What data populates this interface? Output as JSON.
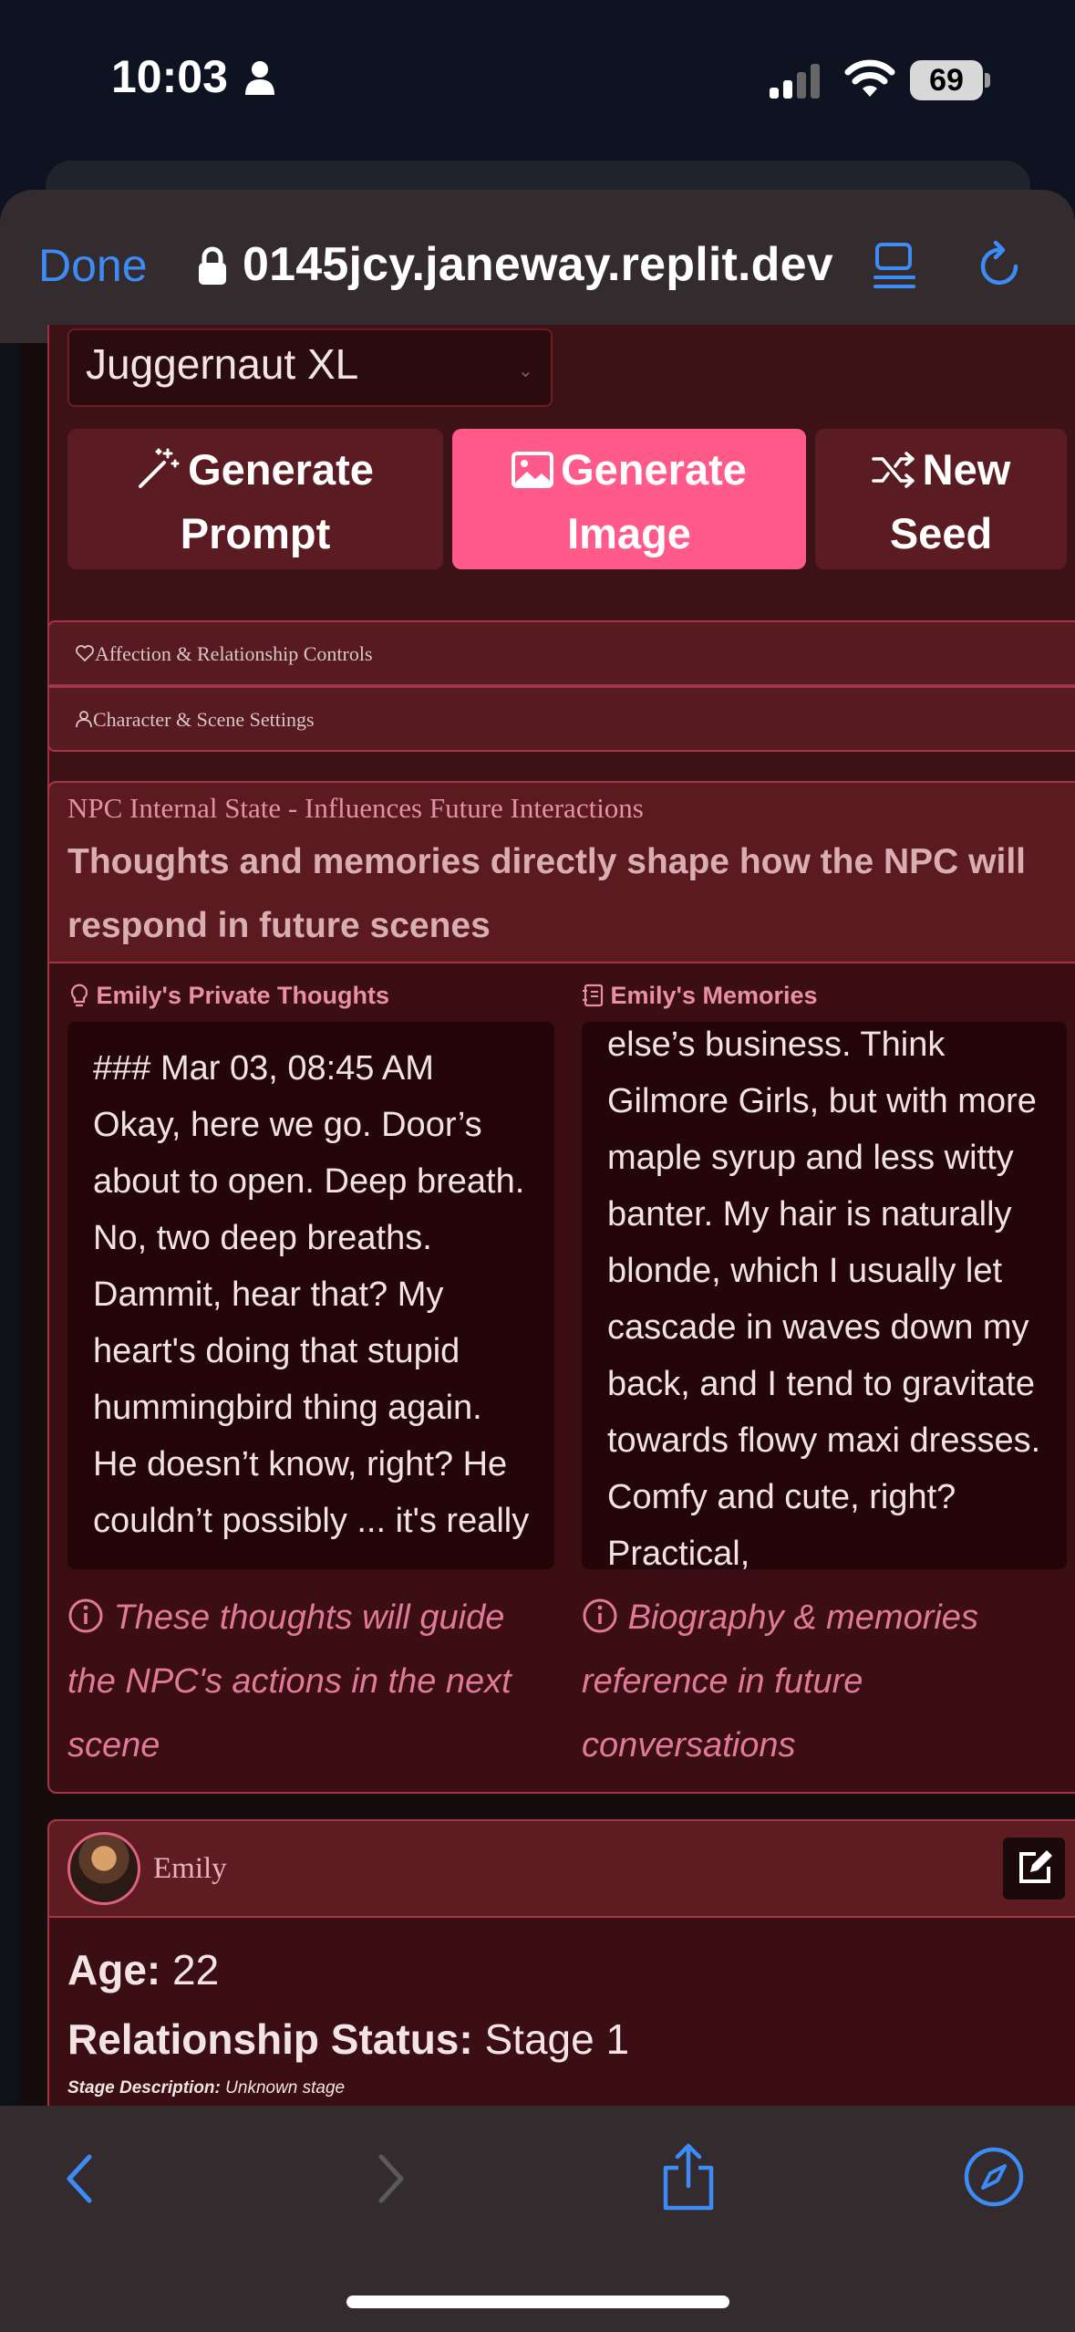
{
  "status_bar": {
    "time": "10:03",
    "battery": "69"
  },
  "browser": {
    "done_label": "Done",
    "url": "0145jcy.janeway.replit.dev"
  },
  "controls": {
    "model_select_value": "Juggernaut XL",
    "generate_prompt_line1": "Generate",
    "generate_prompt_line2": "Prompt",
    "generate_image_line1": "Generate",
    "generate_image_line2": "Image",
    "new_seed_line1": "New",
    "new_seed_line2": "Seed"
  },
  "accordions": {
    "affection_label": "Affection & Relationship Controls",
    "character_label": "Character & Scene Settings"
  },
  "npc_state": {
    "subtitle": "NPC Internal State - Influences Future Interactions",
    "title": "Thoughts and memories directly shape how the NPC will respond in future scenes",
    "thoughts_label": "Emily's Private Thoughts",
    "memories_label": "Emily's Memories",
    "thoughts_text": "### Mar 03, 08:45 AM Okay, here we go. Door’s about to open. Deep breath. No, two deep breaths. Dammit, hear that? My heart's doing that stupid hummingbird thing again. He doesn’t know, right? He couldn’t possibly ... it's really",
    "memories_text": "else’s business. Think Gilmore Girls, but with more maple syrup and less witty banter. My hair is naturally blonde, which I usually let cascade in waves down my back, and I tend to gravitate towards flowy maxi dresses. Comfy and cute, right? Practical,",
    "thoughts_note": "These thoughts will guide the NPC's actions in the next scene",
    "memories_note": "Biography & memories reference in future conversations"
  },
  "character_card": {
    "name": "Emily",
    "age_label": "Age:",
    "age_value": "22",
    "relationship_label": "Relationship Status:",
    "relationship_value": "Stage 1",
    "stage_label": "Stage Description:",
    "stage_value": "Unknown stage"
  },
  "icons": [
    "person-icon",
    "signal-icon",
    "wifi-icon",
    "lock-icon",
    "reader-icon",
    "reload-icon",
    "wand-icon",
    "image-icon",
    "shuffle-icon",
    "heart-icon",
    "user-icon",
    "lightbulb-icon",
    "notebook-icon",
    "info-icon",
    "edit-icon",
    "back-icon",
    "forward-icon",
    "share-icon",
    "compass-icon"
  ],
  "colors": {
    "accent_pink": "#ff5a8a",
    "browser_blue": "#3d8cf5",
    "panel_red": "#5a1a20"
  }
}
